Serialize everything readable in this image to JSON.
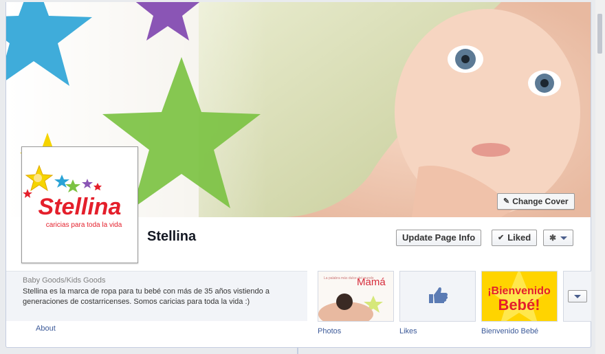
{
  "page": {
    "name": "Stellina",
    "category": "Baby Goods/Kids Goods",
    "description": "Stellina es la marca de ropa para tu bebé con más de 35 años vistiendo a generaciones de costarricenses. Somos caricias para toda la vida :)"
  },
  "cover": {
    "change_cover_label": "Change Cover",
    "pencil_icon": "pencil-icon"
  },
  "logo": {
    "brand": "Stellina",
    "tagline": "caricias para toda la vida"
  },
  "actions": {
    "update_label": "Update Page Info",
    "liked_label": "Liked",
    "check_icon": "check-icon",
    "gear_icon": "gear-icon",
    "chevron_icon": "chevron-down-icon"
  },
  "about": {
    "link_label": "About"
  },
  "apps": [
    {
      "label": "Photos",
      "thumb_title": "Mamá",
      "thumb_small": "La palabra más dulce del mundo"
    },
    {
      "label": "Likes",
      "icon": "thumbs-up-icon"
    },
    {
      "label": "Bienvenido Bebé",
      "thumb_line1": "¡Bienvenido",
      "thumb_line2": "Bebé!"
    }
  ],
  "colors": {
    "accent": "#3b5998",
    "brand_red": "#e41f2b",
    "star_blue": "#2aa3d6",
    "star_green": "#7cc243",
    "star_purple": "#8a55b5",
    "star_yellow": "#f5d400"
  }
}
